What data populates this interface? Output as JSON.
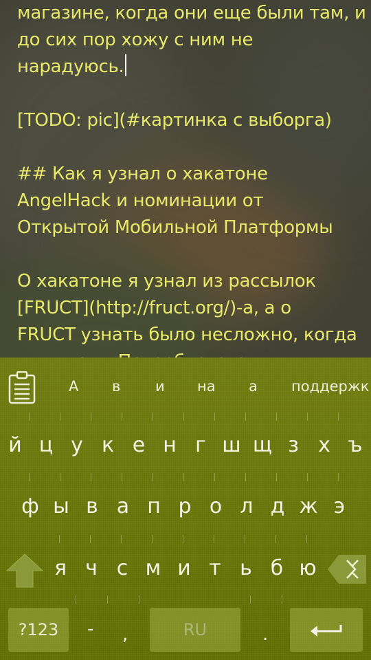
{
  "editor": {
    "lines": [
      "магазине, когда они еще были там, и",
      "до сих пор хожу с ним не",
      "нарадуюсь.",
      "",
      "[TODO: pic](#картинка с выборга)",
      "",
      "## Как я узнал о хакатоне",
      "AngelHack и номинации от",
      "Открытой Мобильной Платформы",
      "",
      "О хакатоне я узнал из рассылок",
      "[FRUCT](http://fruct.org/)-а, а о",
      "FRUCT узнать было несложно, когда",
      "я учился в Петербургском"
    ]
  },
  "keyboard": {
    "suggestions": [
      "А",
      "в",
      "и",
      "на",
      "а",
      "поддержк"
    ],
    "row1": [
      "й",
      "ц",
      "у",
      "к",
      "е",
      "н",
      "г",
      "ш",
      "щ",
      "з",
      "х",
      "ъ"
    ],
    "row2": [
      "ф",
      "ы",
      "в",
      "а",
      "п",
      "р",
      "о",
      "л",
      "д",
      "ж",
      "э"
    ],
    "row3": [
      "я",
      "ч",
      "с",
      "м",
      "и",
      "т",
      "ь",
      "б",
      "ю"
    ],
    "symbols_label": "?123",
    "dash": "-",
    "comma": ",",
    "space_label": "RU",
    "period": ".",
    "colors": {
      "bg": "#67750a",
      "text_editor": "#e8e86a"
    }
  }
}
